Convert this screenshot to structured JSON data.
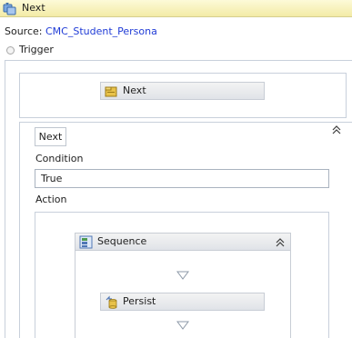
{
  "window": {
    "title": "Next"
  },
  "source": {
    "label": "Source:",
    "value": "CMC_Student_Persona"
  },
  "trigger": {
    "label": "Trigger",
    "activity": {
      "label": "Next",
      "icon": "folder-activity-icon"
    }
  },
  "transition": {
    "tab_label": "Next",
    "condition_label": "Condition",
    "condition_value": "True",
    "action_label": "Action",
    "sequence": {
      "label": "Sequence",
      "icon": "sequence-icon",
      "children": [
        {
          "label": "Persist",
          "icon": "persist-icon"
        }
      ]
    }
  },
  "colors": {
    "title_bg": "#f3eba6",
    "source_link": "#1f3bd6",
    "border": "#c8d0db",
    "activity_bg": "#e0e3e8"
  }
}
